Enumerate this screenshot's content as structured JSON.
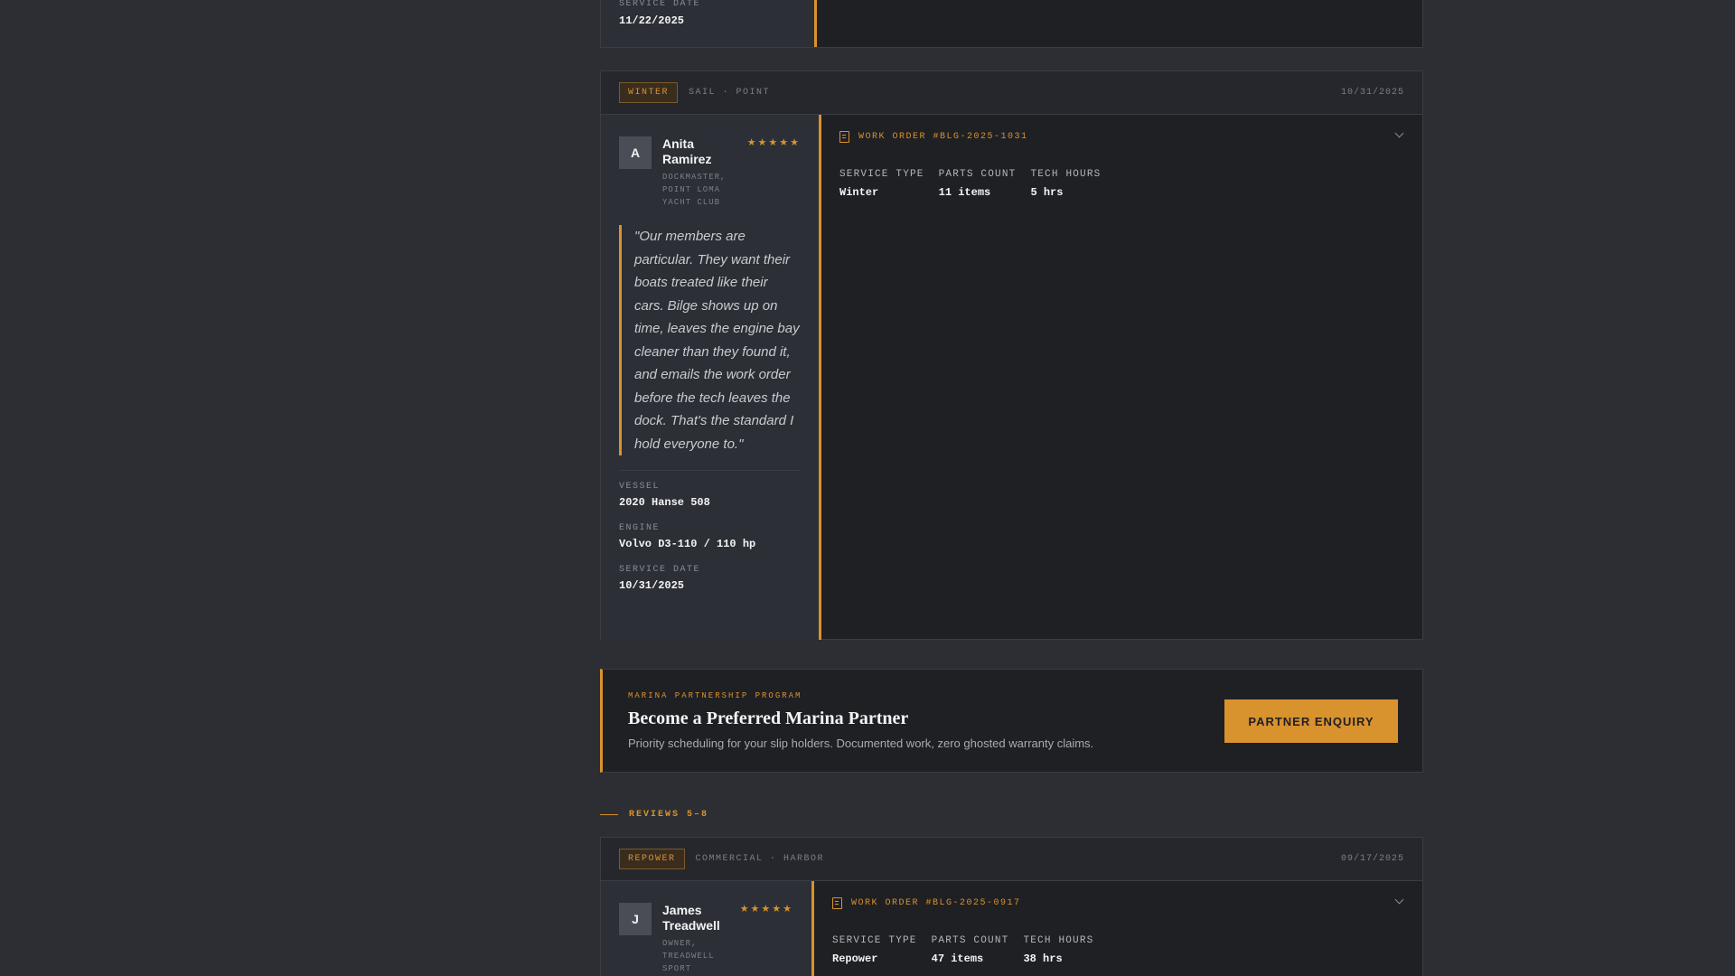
{
  "top_card": {
    "service_date_label": "SERVICE DATE",
    "service_date": "11/22/2025"
  },
  "review_4": {
    "tag": "WINTER",
    "subtag": "SAIL · POINT",
    "date": "10/31/2025",
    "avatar_initial": "A",
    "name": "Anita Ramirez",
    "role": "DOCKMASTER, POINT LOMA YACHT CLUB",
    "stars": "★★★★★",
    "quote": "\"Our members are particular. They want their boats treated like their cars. Bilge shows up on time, leaves the engine bay cleaner than they found it, and emails the work order before the tech leaves the dock. That's the standard I hold everyone to.\"",
    "vessel_label": "VESSEL",
    "vessel": "2020 Hanse 508",
    "engine_label": "ENGINE",
    "engine": "Volvo D3-110 / 110 hp",
    "service_date_label": "SERVICE DATE",
    "service_date": "10/31/2025",
    "work_order": "WORK ORDER #BLG-2025-1031",
    "stat_labels": [
      "SERVICE TYPE",
      "PARTS COUNT",
      "TECH HOURS"
    ],
    "stat_values": [
      "Winter",
      "11 items",
      "5 hrs"
    ]
  },
  "promo": {
    "kicker": "MARINA PARTNERSHIP PROGRAM",
    "title": "Become a Preferred Marina Partner",
    "description": "Priority scheduling for your slip holders. Documented work, zero ghosted warranty claims.",
    "button_label": "PARTNER ENQUIRY"
  },
  "section": {
    "label": "REVIEWS 5–8"
  },
  "review_5": {
    "tag": "REPOWER",
    "subtag": "COMMERCIAL · HARBOR",
    "date": "09/17/2025",
    "avatar_initial": "J",
    "name": "James Treadwell",
    "role": "OWNER, TREADWELL SPORT",
    "stars": "★★★★★",
    "work_order": "WORK ORDER #BLG-2025-0917",
    "stat_labels": [
      "SERVICE TYPE",
      "PARTS COUNT",
      "TECH HOURS"
    ],
    "stat_values": [
      "Repower",
      "47 items",
      "38 hrs"
    ]
  },
  "colors": {
    "accent": "#d8922e",
    "page_background": "#2c2e33",
    "card_background": "#1f2024"
  }
}
